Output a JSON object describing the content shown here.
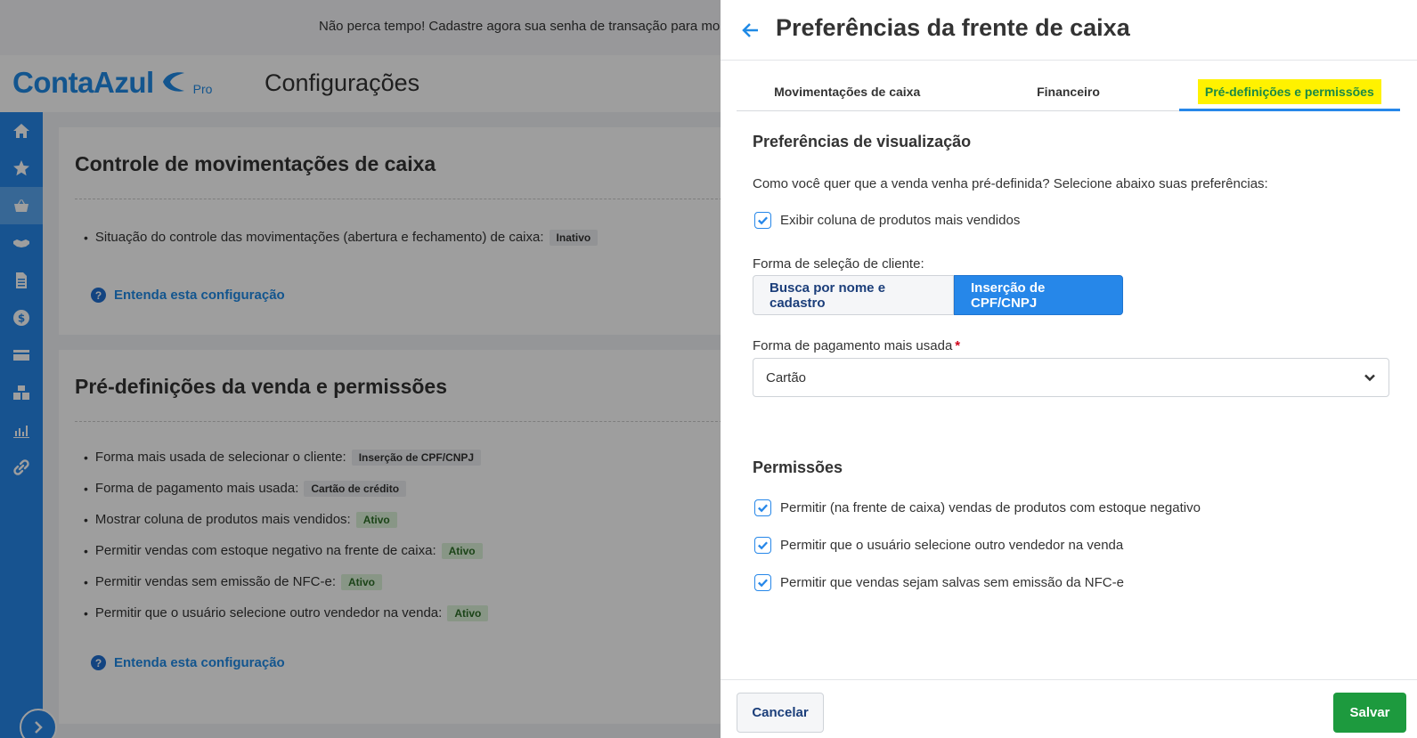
{
  "banner": {
    "text": "Não perca tempo! Cadastre agora sua senha de transação para mo"
  },
  "header": {
    "logo_text": "ContaAzul",
    "logo_badge": "Pro",
    "page_title": "Configurações"
  },
  "sidebar": {
    "items": [
      {
        "icon": "home-icon"
      },
      {
        "icon": "star-icon"
      },
      {
        "icon": "basket-icon",
        "active": true
      },
      {
        "icon": "handshake-icon"
      },
      {
        "icon": "document-icon"
      },
      {
        "icon": "dollar-icon"
      },
      {
        "icon": "card-icon"
      },
      {
        "icon": "boxes-icon"
      },
      {
        "icon": "chart-icon"
      },
      {
        "icon": "link-icon"
      }
    ]
  },
  "cards": {
    "cash_control": {
      "title": "Controle de movimentações de caixa",
      "items": [
        {
          "label": "Situação do controle das movimentações (abertura e fechamento) de caixa:",
          "value": "Inativo"
        }
      ],
      "help": "Entenda esta configuração"
    },
    "sale_defaults": {
      "title": "Pré-definições da venda e permissões",
      "items": [
        {
          "label": "Forma mais usada de selecionar o cliente:",
          "value": "Inserção de CPF/CNPJ"
        },
        {
          "label": "Forma de pagamento mais usada:",
          "value": "Cartão de crédito"
        },
        {
          "label": "Mostrar coluna de produtos mais vendidos:",
          "value": "Ativo"
        },
        {
          "label": "Permitir vendas com estoque negativo na frente de caixa:",
          "value": "Ativo"
        },
        {
          "label": "Permitir vendas sem emissão de NFC-e:",
          "value": "Ativo"
        },
        {
          "label": "Permitir que o usuário selecione outro vendedor na venda:",
          "value": "Ativo"
        }
      ],
      "help": "Entenda esta configuração"
    }
  },
  "drawer": {
    "title": "Preferências da frente de caixa",
    "tabs": [
      {
        "label": "Movimentações de caixa"
      },
      {
        "label": "Financeiro"
      },
      {
        "label": "Pré-definições e permissões",
        "active": true
      }
    ],
    "view_prefs": {
      "title": "Preferências de visualização",
      "prompt": "Como você quer que a venda venha pré-definida? Selecione abaixo suas preferências:",
      "show_top_products": {
        "label": "Exibir coluna de produtos mais vendidos",
        "checked": true
      },
      "client_selection": {
        "label": "Forma de seleção de cliente:",
        "options": [
          {
            "label": "Busca por nome e cadastro",
            "selected": false
          },
          {
            "label": "Inserção de CPF/CNPJ",
            "selected": true
          }
        ]
      },
      "payment_method": {
        "label": "Forma de pagamento mais usada",
        "required_mark": "*",
        "value": "Cartão"
      }
    },
    "permissions": {
      "title": "Permissões",
      "items": [
        {
          "label": "Permitir (na frente de caixa) vendas de produtos com estoque negativo",
          "checked": true
        },
        {
          "label": "Permitir que o usuário selecione outro vendedor na venda",
          "checked": true
        },
        {
          "label": "Permitir que vendas sejam salvas sem emissão da NFC-e",
          "checked": true
        }
      ]
    },
    "footer": {
      "cancel_label": "Cancelar",
      "save_label": "Salvar"
    }
  },
  "colors": {
    "primary": "#2687e9",
    "success": "#1d9a3e",
    "highlight": "#fff200"
  }
}
